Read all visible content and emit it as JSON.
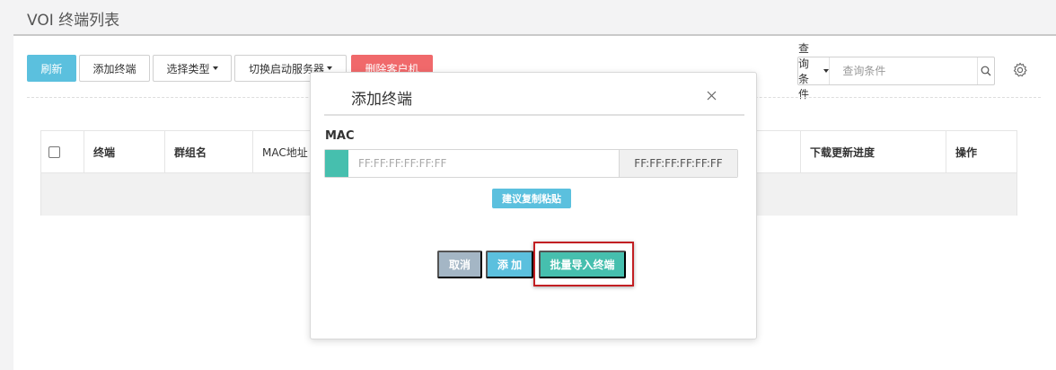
{
  "page": {
    "title": "VOI 终端列表"
  },
  "toolbar": {
    "refresh": "刷新",
    "add_terminal": "添加终端",
    "select_type": "选择类型",
    "switch_server": "切换启动服务器",
    "delete_client": "删除客户机"
  },
  "search": {
    "condition_label": "查询条件",
    "placeholder": "查询条件"
  },
  "table": {
    "columns": [
      "终端",
      "群组名",
      "MAC地址",
      "下载更新进度",
      "操作"
    ],
    "rows": []
  },
  "modal": {
    "title": "添加终端",
    "mac_label": "MAC",
    "mac_placeholder": "FF:FF:FF:FF:FF:FF",
    "mac_addon": "FF:FF:FF:FF:FF:FF",
    "suggest": "建议复制粘贴",
    "cancel": "取消",
    "add": "添 加",
    "batch_import": "批量导入终端"
  },
  "colors": {
    "info": "#5bc0de",
    "danger": "#f0696b",
    "teal": "#46bfae",
    "muted": "#a4b6c5",
    "highlight": "#c21f23"
  },
  "icons": [
    "search-icon",
    "gear-icon",
    "close-icon",
    "chevron-down-icon"
  ]
}
